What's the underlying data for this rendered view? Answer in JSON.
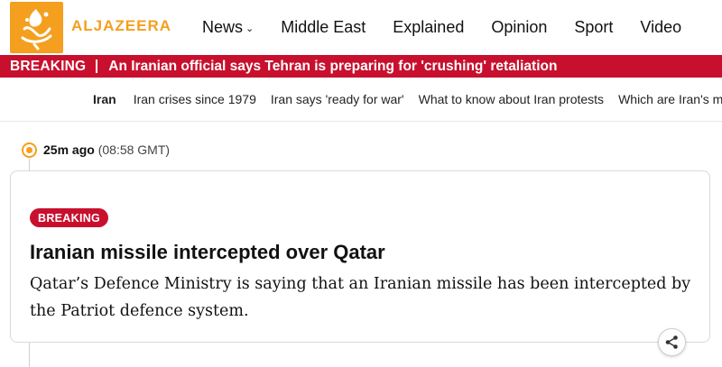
{
  "brand": {
    "name": "ALJAZEERA",
    "logo_icon": "aljazeera-calligraphy-logo",
    "accent_color": "#f49f1e"
  },
  "nav": {
    "items": [
      {
        "label": "News",
        "has_dropdown": true
      },
      {
        "label": "Middle East"
      },
      {
        "label": "Explained"
      },
      {
        "label": "Opinion"
      },
      {
        "label": "Sport"
      },
      {
        "label": "Video"
      }
    ]
  },
  "breaking_bar": {
    "label": "BREAKING",
    "headline": "An Iranian official says Tehran is preparing for 'crushing' retaliation",
    "color": "#c8102e"
  },
  "topics": [
    {
      "label": "Iran",
      "active": true
    },
    {
      "label": "Iran crises since 1979"
    },
    {
      "label": "Iran says 'ready for war'"
    },
    {
      "label": "What to know about Iran protests"
    },
    {
      "label": "Which are Iran's m"
    }
  ],
  "post": {
    "time_ago": "25m ago",
    "time_gmt": "(08:58 GMT)",
    "badge": "BREAKING",
    "title": "Iranian missile intercepted over Qatar",
    "body": "Qatar’s Defence Ministry is saying that an Iranian missile has been intercepted by the Patriot defence system.",
    "share_icon": "share-icon"
  }
}
